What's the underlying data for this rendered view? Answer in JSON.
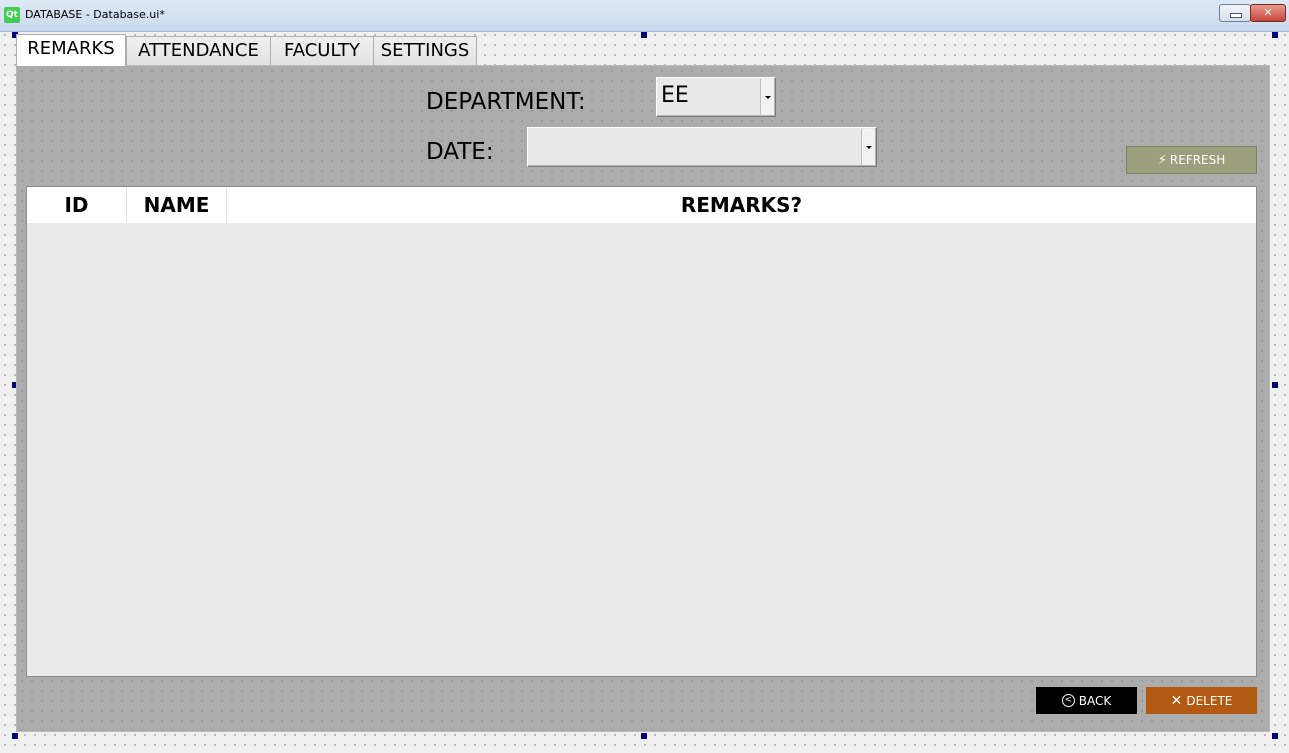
{
  "window": {
    "logo": "Qt",
    "title": "DATABASE - Database.ui*",
    "minimize_icon": "minimize-icon",
    "close_label": "✕"
  },
  "tabs": [
    {
      "label": "REMARKS",
      "active": true
    },
    {
      "label": "ATTENDANCE",
      "active": false
    },
    {
      "label": "FACULTY",
      "active": false
    },
    {
      "label": "SETTINGS",
      "active": false
    }
  ],
  "form": {
    "department_label": "DEPARTMENT:",
    "department_value": "EE",
    "date_label": "DATE:",
    "date_value": ""
  },
  "refresh_button": {
    "label": "REFRESH",
    "icon": "refresh-icon",
    "color": "#9c9f7c"
  },
  "table": {
    "columns": [
      "ID",
      "NAME",
      "REMARKS?"
    ],
    "rows": []
  },
  "actions": {
    "back_label": "BACK",
    "back_icon": "back-icon",
    "back_color": "#000000",
    "delete_label": "DELETE",
    "delete_icon": "close-icon",
    "delete_color": "#b25a12"
  }
}
